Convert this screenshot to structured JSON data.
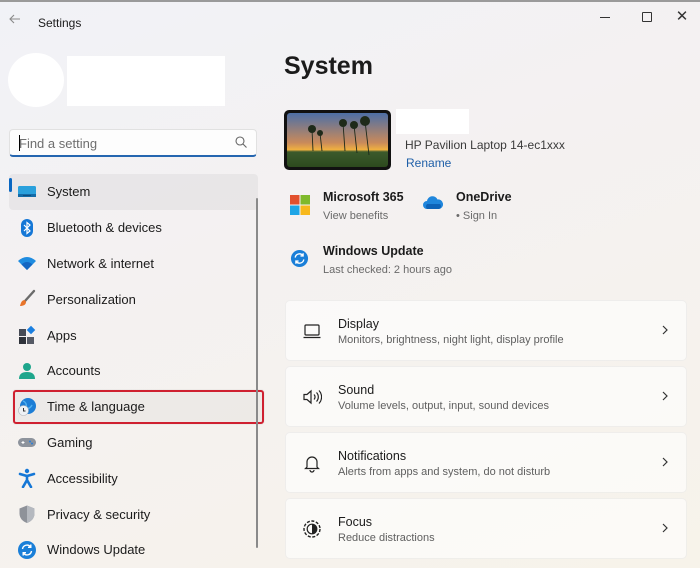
{
  "window": {
    "app_title": "Settings",
    "controls": {
      "minimize": "minimize-icon",
      "maximize": "maximize-icon",
      "close": "✕"
    }
  },
  "sidebar": {
    "search": {
      "placeholder": "Find a setting",
      "value": ""
    },
    "items": [
      {
        "label": "System",
        "icon": "system-display-icon",
        "selected": true
      },
      {
        "label": "Bluetooth & devices",
        "icon": "bluetooth-icon"
      },
      {
        "label": "Network & internet",
        "icon": "wifi-icon"
      },
      {
        "label": "Personalization",
        "icon": "paintbrush-icon"
      },
      {
        "label": "Apps",
        "icon": "apps-icon"
      },
      {
        "label": "Accounts",
        "icon": "person-icon"
      },
      {
        "label": "Time & language",
        "icon": "globe-clock-icon",
        "highlighted": true
      },
      {
        "label": "Gaming",
        "icon": "gamepad-icon"
      },
      {
        "label": "Accessibility",
        "icon": "accessibility-icon"
      },
      {
        "label": "Privacy & security",
        "icon": "shield-icon"
      },
      {
        "label": "Windows Update",
        "icon": "sync-icon"
      }
    ]
  },
  "main": {
    "title": "System",
    "device": {
      "model": "HP Pavilion Laptop 14-ec1xxx",
      "rename_label": "Rename"
    },
    "quick_links": {
      "microsoft365": {
        "title": "Microsoft 365",
        "subtitle": "View benefits"
      },
      "onedrive": {
        "title": "OneDrive",
        "subtitle": "• Sign In"
      },
      "windows_update": {
        "title": "Windows Update",
        "subtitle": "Last checked: 2 hours ago"
      }
    },
    "cards": [
      {
        "title": "Display",
        "subtitle": "Monitors, brightness, night light, display profile",
        "icon": "display-icon"
      },
      {
        "title": "Sound",
        "subtitle": "Volume levels, output, input, sound devices",
        "icon": "speaker-icon"
      },
      {
        "title": "Notifications",
        "subtitle": "Alerts from apps and system, do not disturb",
        "icon": "bell-icon"
      },
      {
        "title": "Focus",
        "subtitle": "Reduce distractions",
        "icon": "focus-icon"
      }
    ]
  },
  "colors": {
    "accent": "#0a67c2",
    "highlight_box": "#cf2030",
    "link": "#1f5fa8"
  }
}
